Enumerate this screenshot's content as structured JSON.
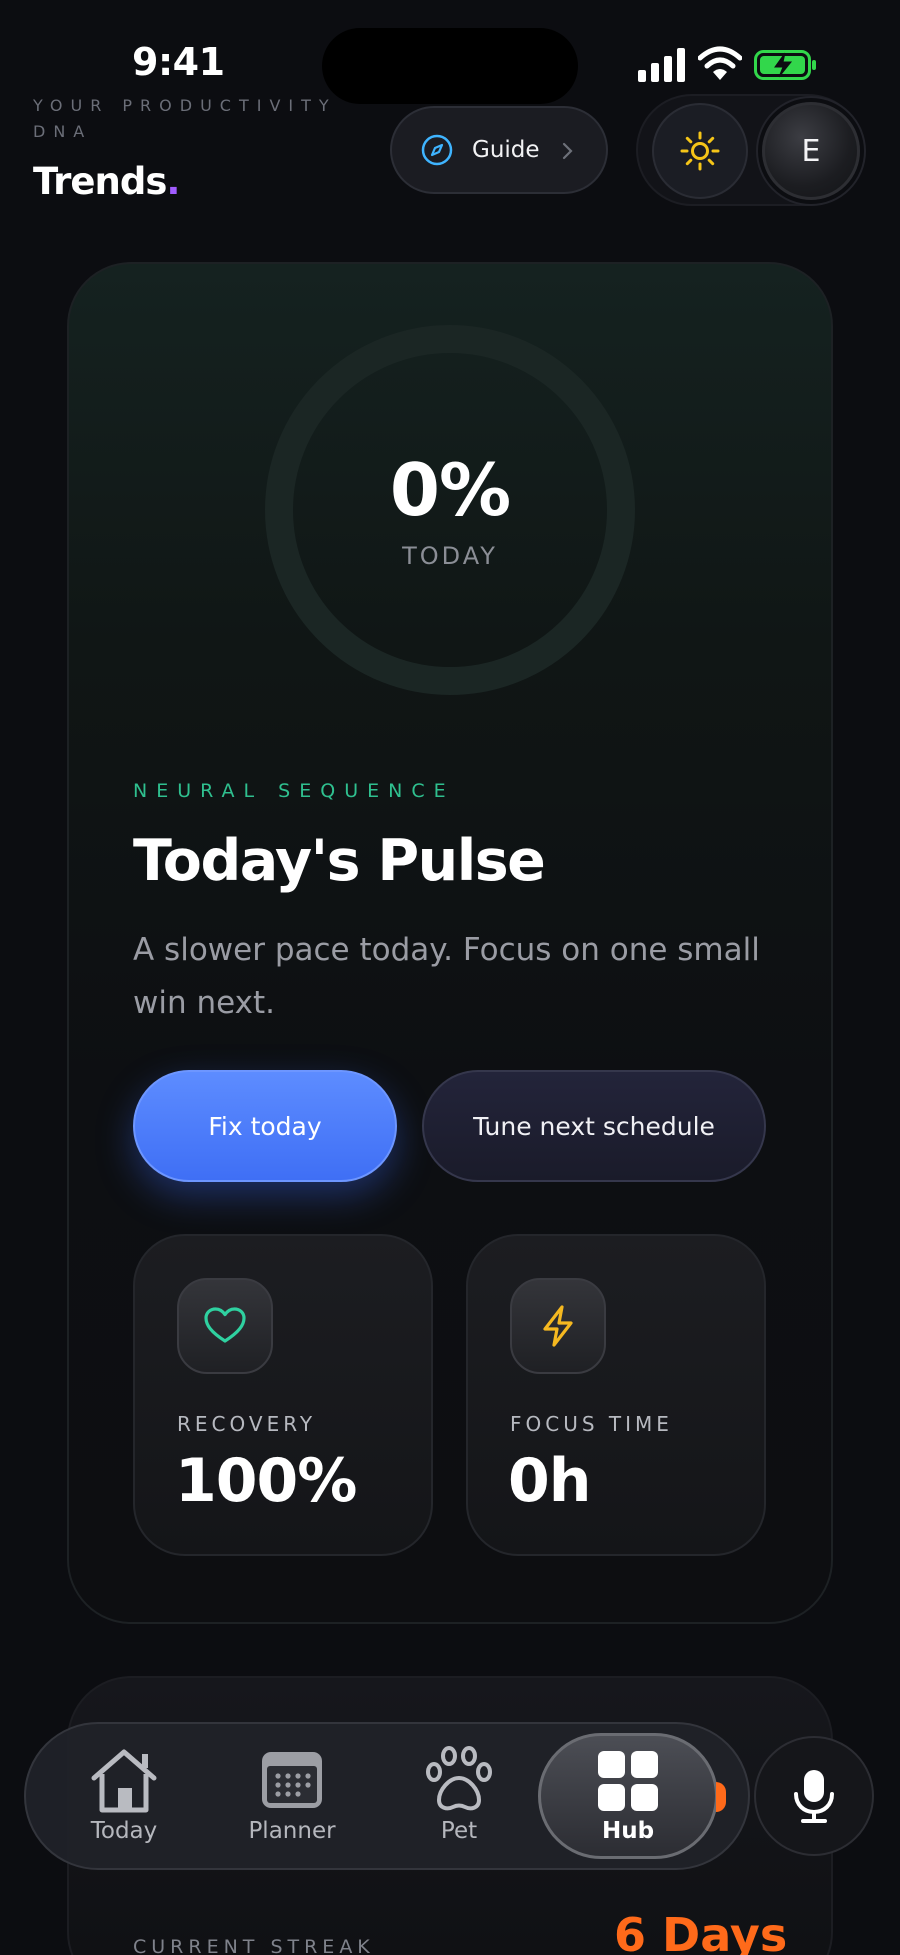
{
  "status_bar": {
    "time": "9:41"
  },
  "header": {
    "eyebrow": "YOUR PRODUCTIVITY DNA",
    "title": "Trends",
    "title_dot": ".",
    "guide_label": "Guide"
  },
  "avatar": {
    "initial": "E"
  },
  "pulse": {
    "percent": "0%",
    "percent_label": "TODAY",
    "sequence_label": "NEURAL SEQUENCE",
    "title": "Today's Pulse",
    "subtitle": "A slower pace today. Focus on one small win next.",
    "fix_label": "Fix today",
    "tune_label": "Tune next schedule"
  },
  "metrics": [
    {
      "label": "RECOVERY",
      "value": "100%",
      "icon": "heart-icon",
      "color": "#2fd1a0"
    },
    {
      "label": "FOCUS TIME",
      "value": "0h",
      "icon": "bolt-icon",
      "color": "#f5b820"
    }
  ],
  "streak": {
    "label": "CURRENT STREAK",
    "value": "6 Days",
    "color": "#ff6a1a"
  },
  "nav": {
    "items": [
      {
        "label": "Today",
        "icon": "home-icon"
      },
      {
        "label": "Planner",
        "icon": "calendar-icon"
      },
      {
        "label": "Pet",
        "icon": "paw-icon"
      },
      {
        "label": "Hub",
        "icon": "grid-icon",
        "active": true
      }
    ]
  },
  "colors": {
    "accent_blue": "#4a7bff",
    "accent_green": "#2fc08f",
    "accent_purple": "#a15cff",
    "sun": "#f5c518"
  }
}
